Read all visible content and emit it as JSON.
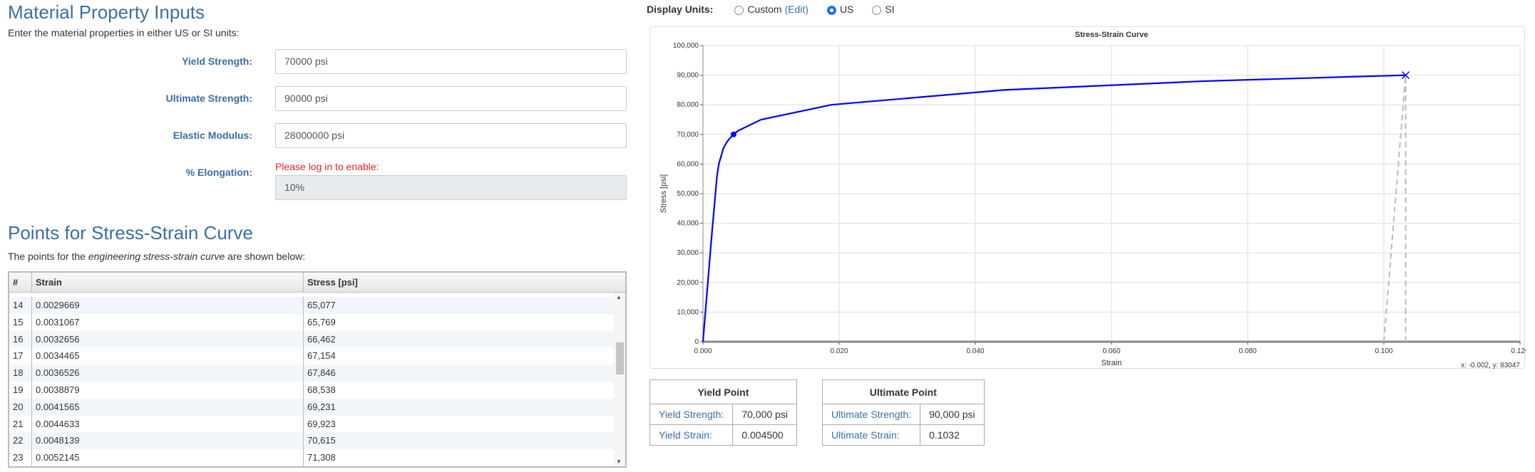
{
  "inputs": {
    "title": "Material Property Inputs",
    "subtitle": "Enter the material properties in either US or SI units:",
    "fields": [
      {
        "label": "Yield Strength:",
        "value": "70000 psi"
      },
      {
        "label": "Ultimate Strength:",
        "value": "90000 psi"
      },
      {
        "label": "Elastic Modulus:",
        "value": "28000000 psi"
      },
      {
        "label": "% Elongation:",
        "value": "10%",
        "warning": "Please log in to enable:"
      }
    ]
  },
  "points": {
    "title": "Points for Stress-Strain Curve",
    "desc_pre": "The points for the ",
    "desc_em": "engineering stress-strain curve",
    "desc_post": " are shown below:",
    "headers": [
      "#",
      "Strain",
      "Stress [psi]"
    ],
    "rows": [
      [
        "14",
        "0.0029669",
        "65,077"
      ],
      [
        "15",
        "0.0031067",
        "65,769"
      ],
      [
        "16",
        "0.0032656",
        "66,462"
      ],
      [
        "17",
        "0.0034465",
        "67,154"
      ],
      [
        "18",
        "0.0036526",
        "67,846"
      ],
      [
        "19",
        "0.0038879",
        "68,538"
      ],
      [
        "20",
        "0.0041565",
        "69,231"
      ],
      [
        "21",
        "0.0044633",
        "69,923"
      ],
      [
        "22",
        "0.0048139",
        "70,615"
      ],
      [
        "23",
        "0.0052145",
        "71,308"
      ]
    ]
  },
  "units": {
    "label": "Display Units:",
    "options": [
      "Custom",
      "US",
      "SI"
    ],
    "edit": "(Edit)",
    "selected": "US"
  },
  "chart_data": {
    "type": "line",
    "title": "Stress-Strain Curve",
    "xlabel": "Strain",
    "ylabel": "Stress [psi]",
    "xlim": [
      0,
      0.12
    ],
    "ylim": [
      0,
      100000
    ],
    "grid": true,
    "xticks": [
      "0.000",
      "0.020",
      "0.040",
      "0.060",
      "0.080",
      "0.100",
      "0.120"
    ],
    "yticks": [
      "0",
      "10,000",
      "20,000",
      "30,000",
      "40,000",
      "50,000",
      "60,000",
      "70,000",
      "80,000",
      "90,000",
      "100,000"
    ],
    "series": [
      {
        "color": "#0000ff",
        "x": [
          0,
          0.00125,
          0.002062,
          0.002324,
          0.0029669,
          0.0031067,
          0.0032656,
          0.0034465,
          0.0036526,
          0.0038879,
          0.0041565,
          0.0044633,
          0.0048139,
          0.0052145,
          0.008535,
          0.01886,
          0.04418,
          0.07368,
          0.1032
        ],
        "y": [
          0,
          35000,
          56000,
          60000,
          65077,
          65769,
          66462,
          67154,
          67846,
          68538,
          69231,
          69923,
          70615,
          71308,
          75000,
          80000,
          85000,
          88000,
          90000
        ]
      }
    ],
    "yield_point": [
      0.0045,
      70000
    ],
    "ultimate_point": [
      0.1032,
      90000
    ],
    "dashed": [
      {
        "x": [
          0.1,
          0.1032
        ],
        "y": [
          0,
          90000
        ]
      },
      {
        "x": [
          0.1032,
          0.1032
        ],
        "y": [
          0,
          90000
        ]
      }
    ],
    "readout": "x: -0.002, y: 83047"
  },
  "yield": {
    "title": "Yield Point",
    "rows": [
      [
        "Yield Strength:",
        "70,000 psi"
      ],
      [
        "Yield Strain:",
        "0.004500"
      ]
    ]
  },
  "ultimate": {
    "title": "Ultimate Point",
    "rows": [
      [
        "Ultimate Strength:",
        "90,000 psi"
      ],
      [
        "Ultimate Strain:",
        "0.1032"
      ]
    ]
  }
}
